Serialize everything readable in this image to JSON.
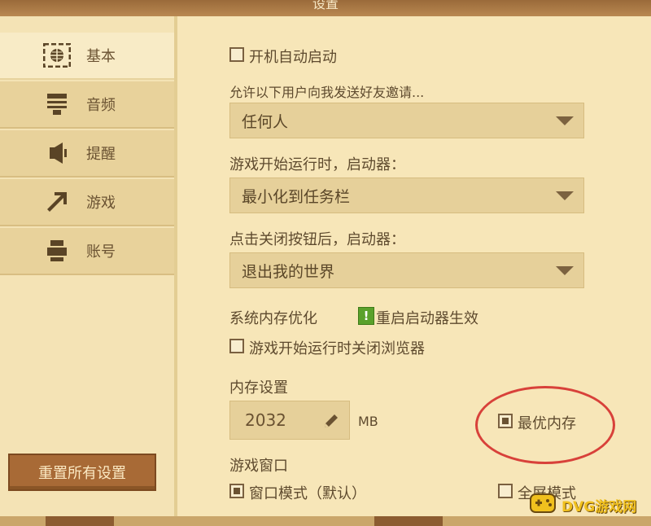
{
  "window": {
    "title": "设置"
  },
  "sidebar": {
    "items": [
      {
        "label": "基本",
        "icon": "globe-icon",
        "active": true
      },
      {
        "label": "音频",
        "icon": "speaker-icon",
        "active": false
      },
      {
        "label": "提醒",
        "icon": "bell-icon",
        "active": false
      },
      {
        "label": "游戏",
        "icon": "pickaxe-icon",
        "active": false
      },
      {
        "label": "账号",
        "icon": "account-icon",
        "active": false
      }
    ],
    "reset_label": "重置所有设置"
  },
  "settings": {
    "autostart_label": "开机自动启动",
    "autostart_checked": false,
    "friend_invite_label": "允许以下用户向我发送好友邀请...",
    "friend_invite_value": "任何人",
    "on_game_start_label": "游戏开始运行时，启动器：",
    "on_game_start_value": "最小化到任务栏",
    "on_close_label": "点击关闭按钮后，启动器：",
    "on_close_value": "退出我的世界",
    "memory_opt_label": "系统内存优化",
    "restart_notice": "重启启动器生效",
    "close_browser_label": "游戏开始运行时关闭浏览器",
    "close_browser_checked": false,
    "memory_section_label": "内存设置",
    "memory_value": "2032",
    "memory_unit": "MB",
    "optimal_memory_label": "最优内存",
    "optimal_memory_checked": true,
    "window_section_label": "游戏窗口",
    "window_mode_label": "窗口模式（默认）",
    "window_mode_checked": true,
    "fullscreen_label": "全屏模式",
    "fullscreen_checked": false
  },
  "watermark": {
    "text": "DVG游戏网"
  },
  "colors": {
    "background": "#f7e6b8",
    "accent_button": "#a86a36",
    "highlight_circle": "#d8413a",
    "notice_green": "#5aa12b"
  }
}
